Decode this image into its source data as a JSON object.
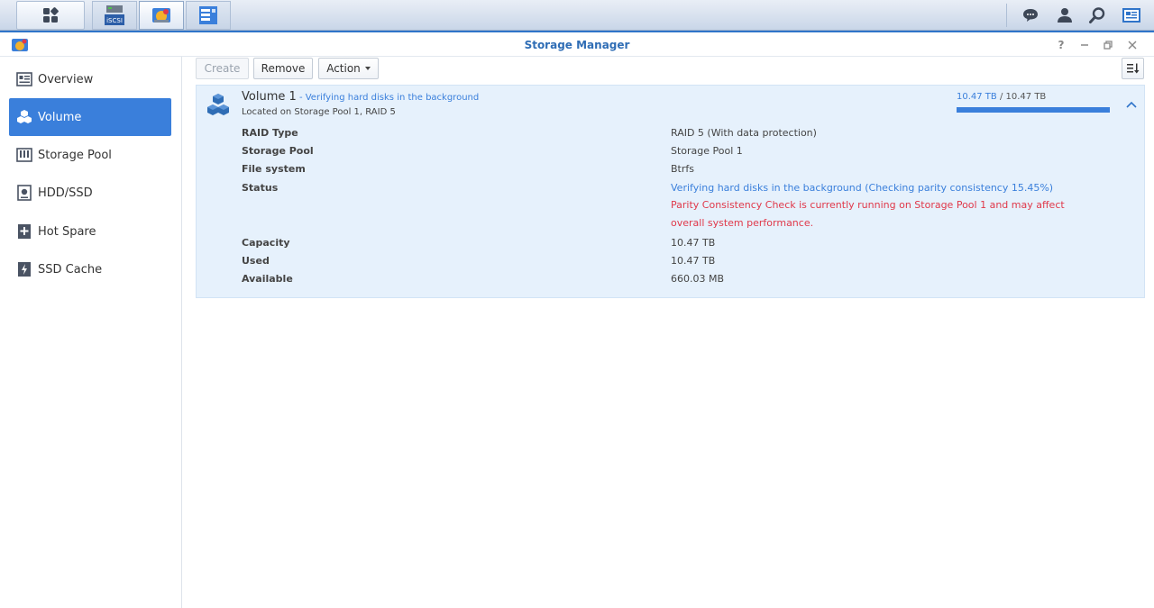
{
  "taskbar": {
    "apps": [
      {
        "name": "main-menu",
        "icon": "grid-icon"
      },
      {
        "name": "iscsi-manager",
        "icon": "iscsi-icon",
        "label": "iSCSI"
      },
      {
        "name": "storage-manager",
        "icon": "storage-manager-icon"
      },
      {
        "name": "control-panel",
        "icon": "panel-icon"
      }
    ],
    "tray": [
      "chat-icon",
      "user-icon",
      "search-icon",
      "widgets-icon"
    ]
  },
  "window": {
    "title": "Storage Manager",
    "controls": [
      "help-icon",
      "minimize-icon",
      "restore-icon",
      "close-icon"
    ]
  },
  "sidebar": {
    "items": [
      {
        "label": "Overview",
        "icon": "overview-icon",
        "active": false
      },
      {
        "label": "Volume",
        "icon": "volume-icon",
        "active": true
      },
      {
        "label": "Storage Pool",
        "icon": "storage-pool-icon",
        "active": false
      },
      {
        "label": "HDD/SSD",
        "icon": "hdd-icon",
        "active": false
      },
      {
        "label": "Hot Spare",
        "icon": "hot-spare-icon",
        "active": false
      },
      {
        "label": "SSD Cache",
        "icon": "ssd-cache-icon",
        "active": false
      }
    ]
  },
  "toolbar": {
    "create_label": "Create",
    "remove_label": "Remove",
    "action_label": "Action"
  },
  "volume": {
    "name": "Volume 1",
    "separator": " - ",
    "status_short": "Verifying hard disks in the background",
    "location": "Located on Storage Pool 1, RAID 5",
    "used": "10.47 TB",
    "usage_separator": " / ",
    "total": "10.47 TB",
    "usage_fraction": 1.0,
    "details": {
      "raid_type_label": "RAID Type",
      "raid_type_value": "RAID 5 (With data protection)",
      "storage_pool_label": "Storage Pool",
      "storage_pool_value": "Storage Pool 1",
      "file_system_label": "File system",
      "file_system_value": "Btrfs",
      "status_label": "Status",
      "status_value": "Verifying hard disks in the background (Checking parity consistency 15.45%)",
      "status_warning": "Parity Consistency Check is currently running on Storage Pool 1 and may affect overall system performance.",
      "capacity_label": "Capacity",
      "capacity_value": "10.47 TB",
      "used_label": "Used",
      "used_value": "10.47 TB",
      "available_label": "Available",
      "available_value": "660.03 MB"
    }
  },
  "colors": {
    "accent": "#3a7fdb",
    "warning": "#e0384a",
    "panel_bg": "#e6f1fc"
  }
}
